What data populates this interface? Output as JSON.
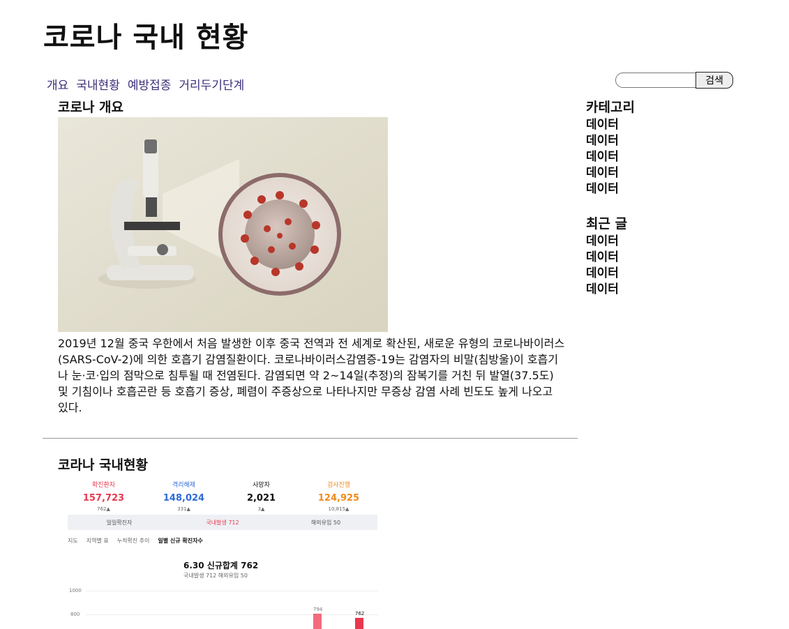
{
  "site": {
    "title": "코로나 국내 현황"
  },
  "nav": {
    "items": [
      "개요",
      "국내현황",
      "예방접종",
      "거리두기단계"
    ]
  },
  "search": {
    "placeholder": "",
    "button_label": "검색"
  },
  "overview": {
    "heading": "코로나 개요",
    "paragraph": "2019년 12월 중국 우한에서 처음 발생한 이후 중국 전역과 전 세계로 확산된, 새로운 유형의 코로나바이러스(SARS-CoV-2)에 의한 호흡기 감염질환이다. 코로나바이러스감염증-19는 감염자의 비말(침방울)이 호흡기나 눈·코·입의 점막으로 침투될 때 전염된다. 감염되면 약 2~14일(추정)의 잠복기를 거친 뒤 발열(37.5도) 및 기침이나 호흡곤란 등 호흡기 증상, 폐렴이 주증상으로 나타나지만 무증상 감염 사례 빈도도 높게 나오고 있다."
  },
  "status": {
    "heading": "코라나 국내현황",
    "stats": [
      {
        "label": "확진환자",
        "value": "157,723",
        "delta": "762▲",
        "color": "#e8384f"
      },
      {
        "label": "격리해제",
        "value": "148,024",
        "delta": "331▲",
        "color": "#2f6bd8"
      },
      {
        "label": "사망자",
        "value": "2,021",
        "delta": "3▲",
        "color": "#222222"
      },
      {
        "label": "검사진행",
        "value": "124,925",
        "delta": "10,815▲",
        "color": "#f08a1a"
      }
    ],
    "summary_row": {
      "a": "일일확진자",
      "b": "국내발생 712",
      "c": "해외유입 50"
    },
    "small_tabs": [
      "지도",
      "지역별 표",
      "누적확진 추이",
      "일별 신규 확진자수"
    ],
    "chart_heading": "6.30 신규합계 762",
    "chart_sub": "국내발생 712  해외유입 50",
    "axis_ticks": [
      "1000",
      "800"
    ],
    "bar_labels": [
      "794",
      "762"
    ]
  },
  "sidebar": {
    "category_heading": "카테고리",
    "category_items": [
      "데이터",
      "데이터",
      "데이터",
      "데이터",
      "데이터"
    ],
    "recent_heading": "최근 글",
    "recent_items": [
      "데이터",
      "데이터",
      "데이터",
      "데이터"
    ]
  }
}
